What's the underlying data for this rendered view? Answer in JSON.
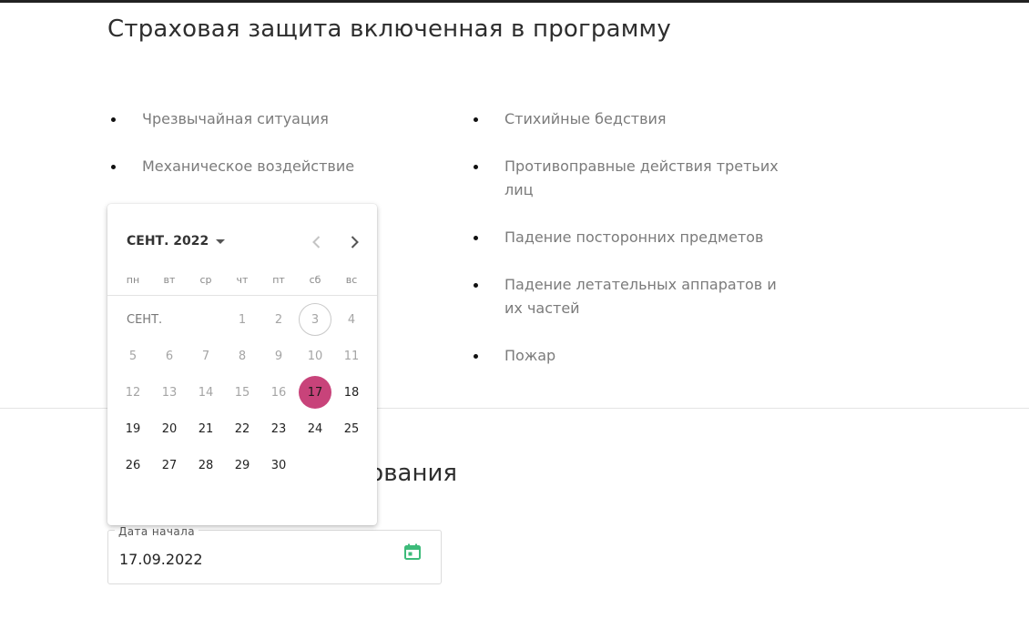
{
  "page": {
    "title": "Страховая защита включенная в программу",
    "coverage_left": [
      "Чрезвычайная ситуация",
      "Механическое воздействие"
    ],
    "coverage_right": [
      "Стихийные бедствия",
      "Противоправные действия третьих лиц",
      "Падение посторонних предметов",
      "Падение летательных аппаратов и их частей",
      "Пожар"
    ],
    "section2_title_visible": "ования"
  },
  "start_date_field": {
    "label": "Дата начала",
    "value": "17.09.2022",
    "icon": "calendar-icon",
    "icon_color": "#3dbb7a"
  },
  "date_picker": {
    "month_label": "СЕНТ. 2022",
    "month_short": "СЕНТ.",
    "weekdays": [
      "пн",
      "вт",
      "ср",
      "чт",
      "пт",
      "сб",
      "вс"
    ],
    "first_weekday_index": 3,
    "days_in_month": 30,
    "today": 3,
    "selected": 17,
    "min_enabled_day": 18,
    "selected_color": "#c8437a"
  }
}
